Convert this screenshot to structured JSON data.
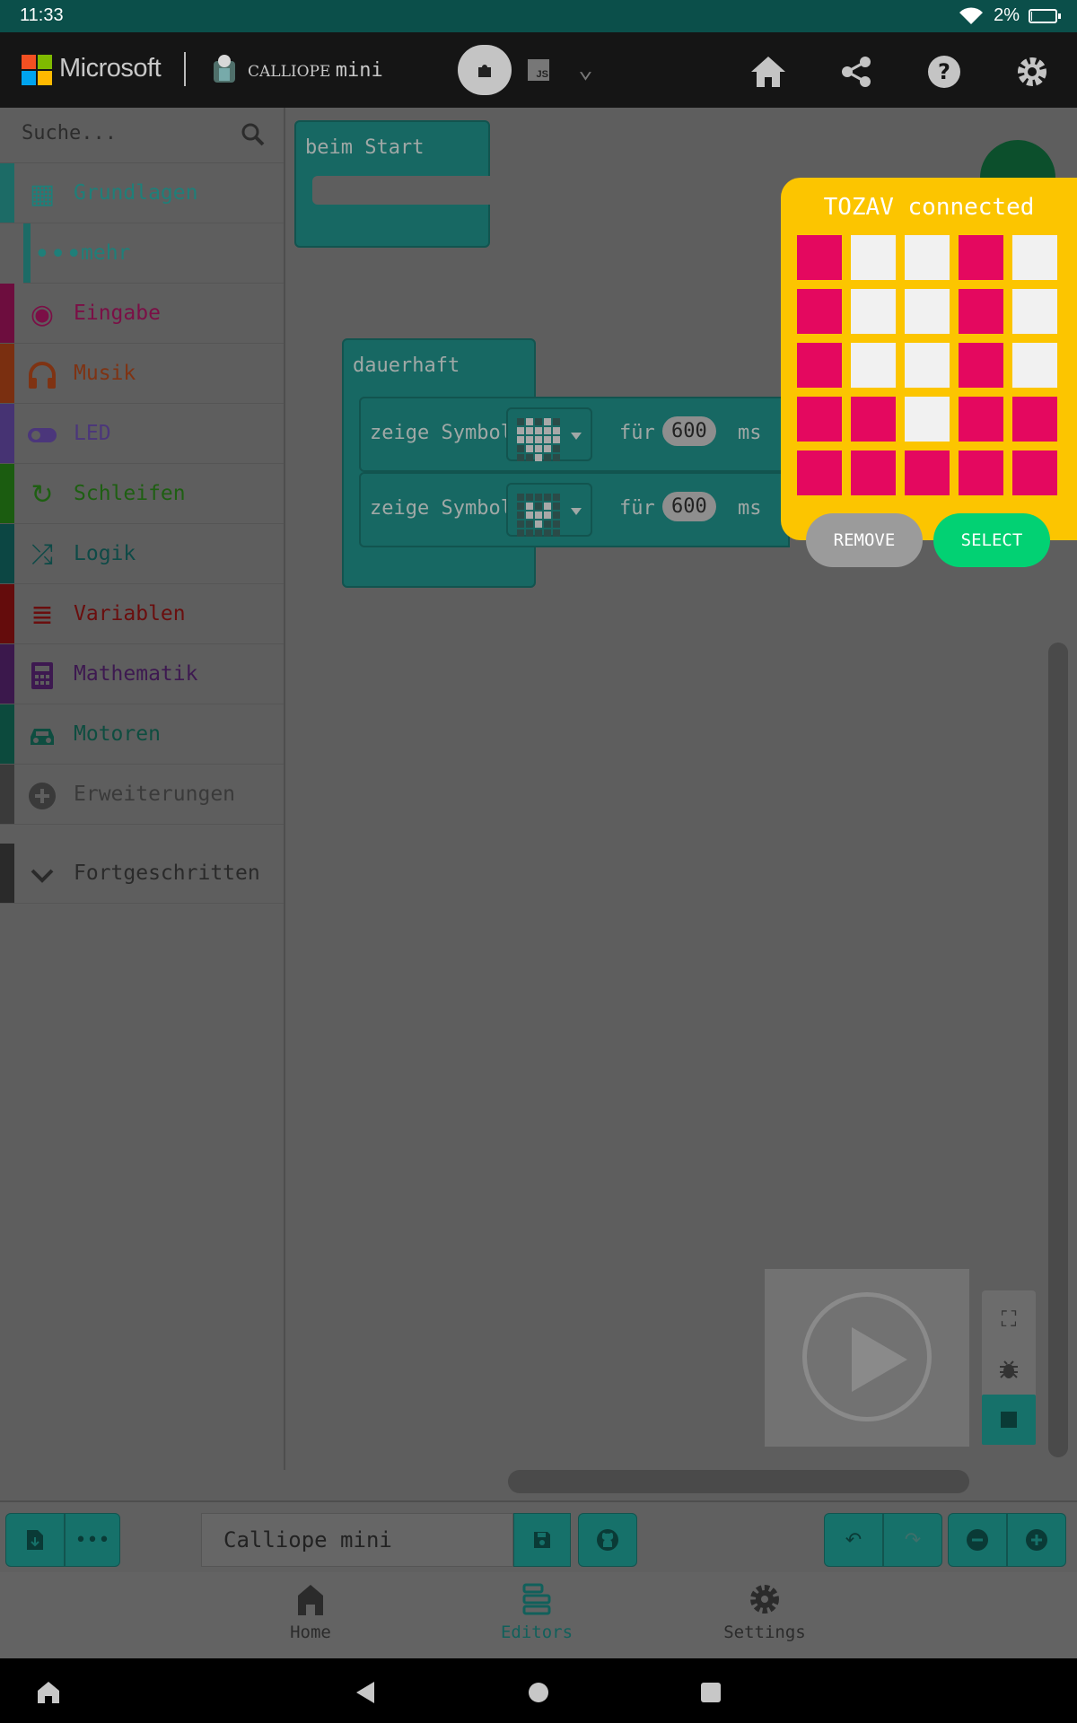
{
  "status_bar": {
    "time": "11:33",
    "battery_text": "2%",
    "battery_level": 0.02
  },
  "topbar": {
    "brand": "Microsoft",
    "product_prefix": "CALLIOPE",
    "product_suffix": "mini",
    "mode_js_label": "JS",
    "icons": [
      "home-icon",
      "share-icon",
      "help-icon",
      "settings-icon"
    ]
  },
  "sidebar": {
    "search_placeholder": "Suche...",
    "categories": [
      {
        "label": "Grundlagen",
        "icon": "grid-icon",
        "color": "#1f7f79"
      },
      {
        "label": "mehr",
        "icon": "more-dots-icon",
        "color": "#1f7f79"
      },
      {
        "label": "Eingabe",
        "icon": "target-icon",
        "color": "#7b0f46"
      },
      {
        "label": "Musik",
        "icon": "headphones-icon",
        "color": "#7f3313"
      },
      {
        "label": "LED",
        "icon": "toggle-icon",
        "color": "#4b367b"
      },
      {
        "label": "Schleifen",
        "icon": "loop-icon",
        "color": "#1e5f12"
      },
      {
        "label": "Logik",
        "icon": "shuffle-icon",
        "color": "#0e4a47"
      },
      {
        "label": "Variablen",
        "icon": "list-icon",
        "color": "#6a0e0e"
      },
      {
        "label": "Mathematik",
        "icon": "calculator-icon",
        "color": "#3d1950"
      },
      {
        "label": "Motoren",
        "icon": "car-icon",
        "color": "#0e4d40"
      },
      {
        "label": "Erweiterungen",
        "icon": "plus-circle-icon",
        "color": "#3a3a3a"
      },
      {
        "label": "Fortgeschritten",
        "icon": "chevron-down-icon",
        "color": "#2a2a2a"
      }
    ]
  },
  "workspace": {
    "on_start_label": "beim Start",
    "forever_label": "dauerhaft",
    "rows": [
      {
        "label": "zeige Symbol",
        "for_label": "für",
        "ms_value": "600",
        "unit": "ms",
        "pattern": "heart"
      },
      {
        "label": "zeige Symbol",
        "for_label": "für",
        "ms_value": "600",
        "unit": "ms",
        "pattern": "small-heart"
      }
    ]
  },
  "device_dialog": {
    "title": "TOZAV connected",
    "led_pattern": [
      [
        1,
        0,
        0,
        1,
        0
      ],
      [
        1,
        0,
        0,
        1,
        0
      ],
      [
        1,
        0,
        0,
        1,
        0
      ],
      [
        1,
        1,
        0,
        1,
        1
      ],
      [
        1,
        1,
        1,
        1,
        1
      ]
    ],
    "remove_label": "REMOVE",
    "select_label": "SELECT"
  },
  "bottom_toolbar": {
    "project_name": "Calliope mini"
  },
  "bottom_nav": {
    "items": [
      {
        "label": "Home",
        "icon": "home-app-icon"
      },
      {
        "label": "Editors",
        "icon": "editors-icon"
      },
      {
        "label": "Settings",
        "icon": "gear-icon"
      }
    ]
  }
}
